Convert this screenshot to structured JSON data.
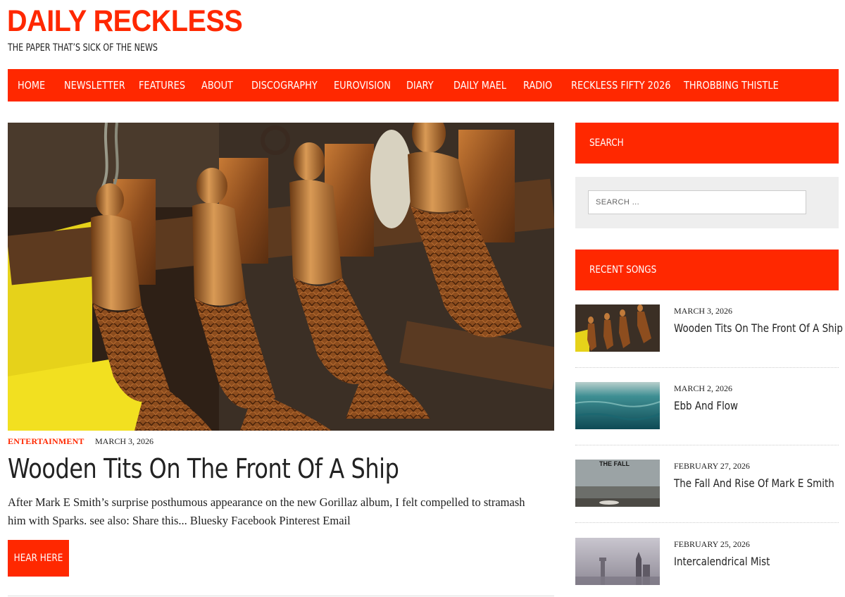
{
  "site": {
    "title": "DAILY RECKLESS",
    "tagline": "THE PAPER THAT’S SICK OF THE NEWS"
  },
  "nav": {
    "items": [
      "HOME",
      "NEWSLETTER",
      "FEATURES",
      "ABOUT",
      "DISCOGRAPHY",
      "EUROVISION",
      "DIARY",
      "DAILY MAEL",
      "RADIO",
      "RECKLESS FIFTY 2026",
      "THROBBING THISTLE"
    ]
  },
  "post": {
    "category": "ENTERTAINMENT",
    "date": "MARCH 3, 2026",
    "title": "Wooden Tits On The Front Of A Ship",
    "excerpt": "  After Mark E Smith’s surprise posthumous appearance on the new Gorillaz album, I felt compelled to stramash him with Sparks. see also: Share this... Bluesky Facebook Pinterest Email",
    "button": "HEAR HERE"
  },
  "sidebar": {
    "search_heading": "SEARCH",
    "search_placeholder": "SEARCH ...",
    "recent_heading": "RECENT SONGS",
    "songs": [
      {
        "date": "MARCH 3, 2026",
        "title": "Wooden Tits On The Front Of A Ship"
      },
      {
        "date": "MARCH 2, 2026",
        "title": "Ebb And Flow"
      },
      {
        "date": "FEBRUARY 27, 2026",
        "title": "The Fall And Rise Of Mark E Smith",
        "thumb_text": "THE FALL"
      },
      {
        "date": "FEBRUARY 25, 2026",
        "title": "Intercalendrical Mist"
      }
    ]
  },
  "colors": {
    "accent": "#ff2800",
    "text": "#222222",
    "widget_bg": "#eeeeee"
  }
}
